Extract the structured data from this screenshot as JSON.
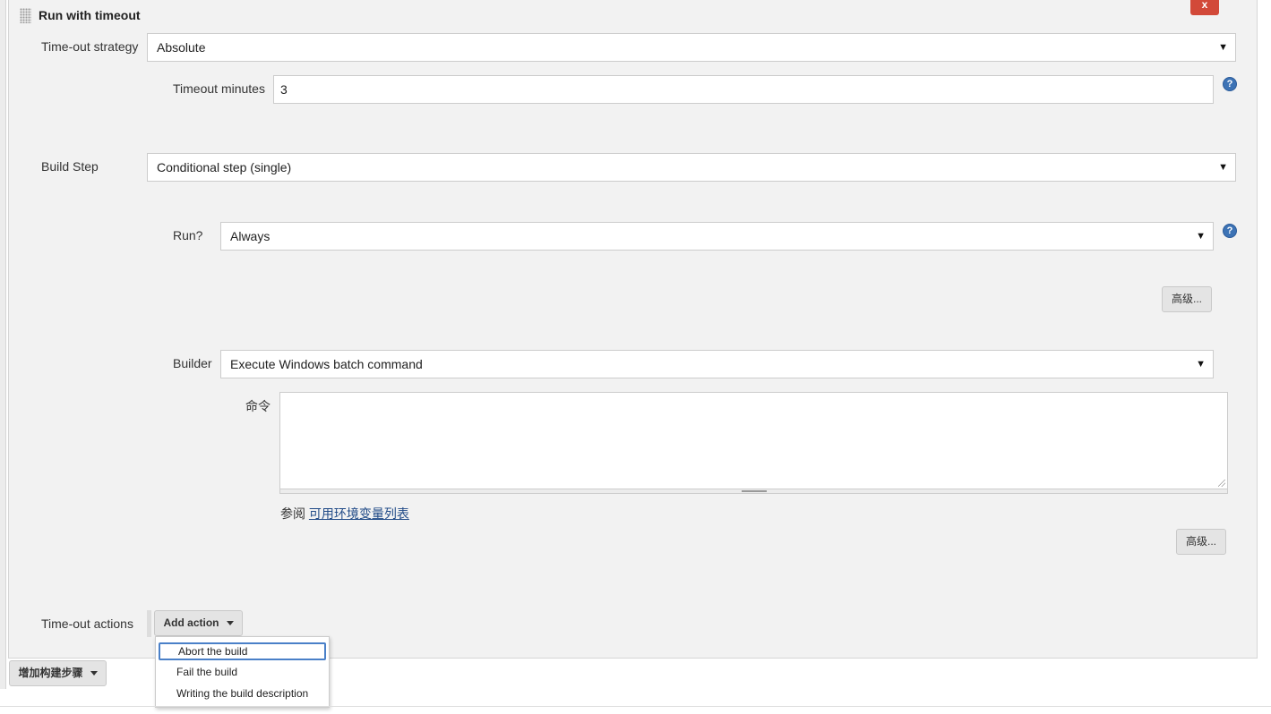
{
  "section": {
    "title": "Run with timeout",
    "delete_label": "x"
  },
  "timeout_strategy": {
    "label": "Time-out strategy",
    "value": "Absolute"
  },
  "timeout_minutes": {
    "label": "Timeout minutes",
    "value": "3"
  },
  "build_step": {
    "label": "Build Step",
    "value": "Conditional step (single)"
  },
  "run_condition": {
    "label": "Run?",
    "value": "Always"
  },
  "advanced_button_1": "高级...",
  "builder": {
    "label": "Builder",
    "value": "Execute Windows batch command"
  },
  "command": {
    "label": "命令",
    "value": "",
    "see_prefix": "参阅",
    "env_link": "可用环境变量列表"
  },
  "advanced_button_2": "高级...",
  "timeout_actions": {
    "label": "Time-out actions",
    "add_action_label": "Add action",
    "menu_items": [
      "Abort the build",
      "Fail the build",
      "Writing the build description"
    ]
  },
  "add_build_step_label": "增加构建步骤",
  "icons": {
    "help": "question-circle-icon",
    "select_arrow": "triangle-down-icon",
    "drag_handle": "drag-handle-icon"
  },
  "colors": {
    "panel_bg": "#f2f2f2",
    "delete_button": "#d24939",
    "help_icon": "#3d73b5",
    "link": "#204a87",
    "menu_focus": "#4a80c8"
  }
}
